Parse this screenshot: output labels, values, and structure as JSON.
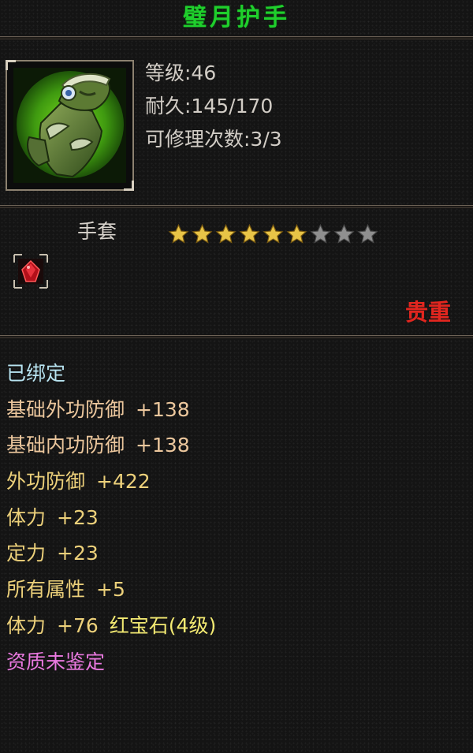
{
  "item": {
    "name": "璧月护手",
    "level": "等级:46",
    "durability": "耐久:145/170",
    "repairs": "可修理次数:3/3",
    "type": "手套",
    "stars_filled": 6,
    "stars_total": 9,
    "quality": "贵重"
  },
  "colors": {
    "title": "#1fcf2c",
    "quality": "#e3261f",
    "star_filled": "#e8c447",
    "star_empty": "#8f8f8f"
  },
  "attributes": [
    {
      "name": "已绑定",
      "value": "",
      "extra": "",
      "color": "bound"
    },
    {
      "name": "基础外功防御",
      "value": "+138",
      "extra": "",
      "color": "base"
    },
    {
      "name": "基础内功防御",
      "value": "+138",
      "extra": "",
      "color": "base"
    },
    {
      "name": "外功防御",
      "value": "+422",
      "extra": "",
      "color": "gold"
    },
    {
      "name": "体力",
      "value": "+23",
      "extra": "",
      "color": "gold"
    },
    {
      "name": "定力",
      "value": "+23",
      "extra": "",
      "color": "gold"
    },
    {
      "name": "所有属性",
      "value": "+5",
      "extra": "",
      "color": "gold"
    },
    {
      "name": "体力",
      "value": "+76",
      "extra": "红宝石(4级)",
      "color": "gold"
    },
    {
      "name": "资质未鉴定",
      "value": "",
      "extra": "",
      "color": "pink"
    }
  ],
  "icons": {
    "item": "gauntlet-icon",
    "gem": "red-gem-icon",
    "star": "star-icon"
  }
}
